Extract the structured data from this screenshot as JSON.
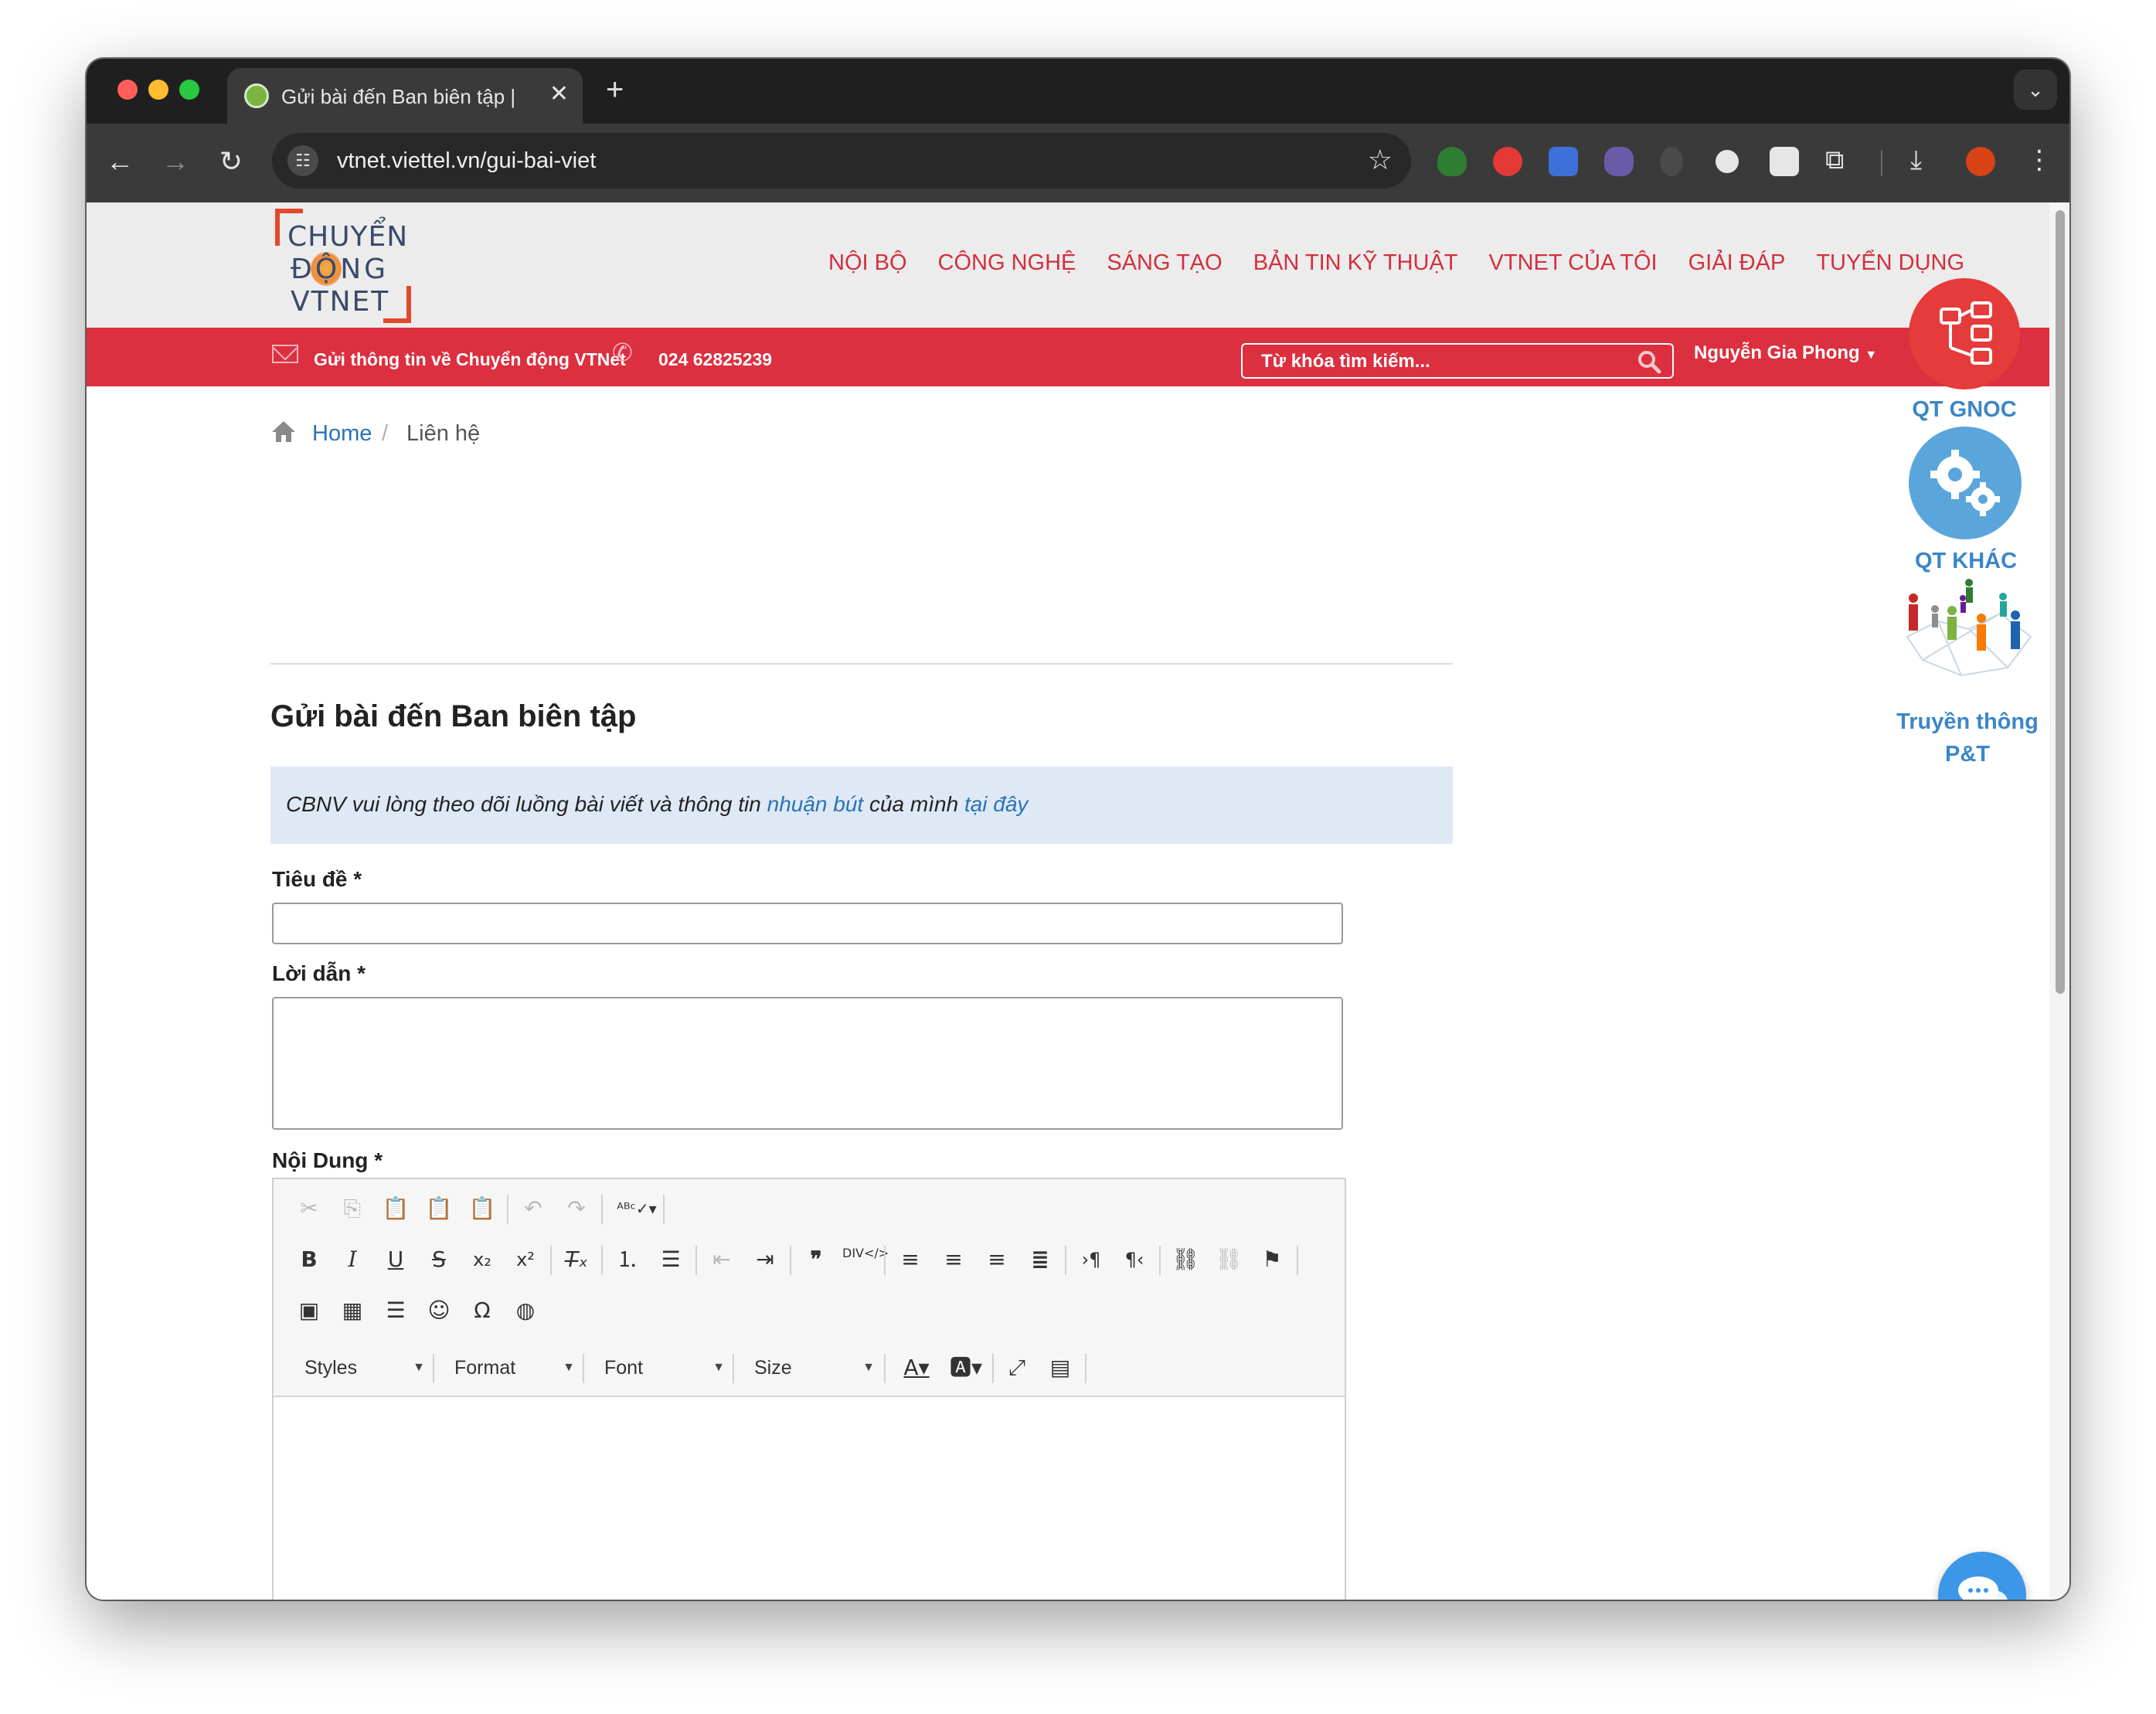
{
  "browser": {
    "tab_title": "Gửi bài đến Ban biên tập | Chuyển động VTNet",
    "tab_close": "✕",
    "new_tab": "+",
    "url": "vtnet.viettel.vn/gui-bai-viet"
  },
  "site": {
    "logo": {
      "line1": "CHUYỂN",
      "line2": "ĐỘNG",
      "line3": "VTNET"
    },
    "nav": [
      "NỘI BỘ",
      "CÔNG NGHỆ",
      "SÁNG TẠO",
      "BẢN TIN KỸ THUẬT",
      "VTNET CỦA TÔI",
      "GIẢI ĐÁP",
      "TUYỂN DỤNG"
    ],
    "topbar": {
      "mail_text": "Gửi thông tin về Chuyển động VTNet",
      "phone": "024 62825239",
      "search_placeholder": "Từ khóa tìm kiếm...",
      "user": "Nguyễn Gia Phong"
    }
  },
  "breadcrumb": {
    "home": "Home",
    "separator": "/",
    "current": "Liên hệ"
  },
  "page_title": "Gửi bài đến Ban biên tập",
  "notice": {
    "before": "CBNV vui lòng theo dõi luồng bài viết và thông tin ",
    "link1": "nhuận bút",
    "middle": " của mình ",
    "link2": "tại đây"
  },
  "form": {
    "title_label": "Tiêu đề *",
    "title_value": "",
    "lead_label": "Lời dẫn *",
    "lead_value": "",
    "content_label": "Nội Dung *"
  },
  "editor": {
    "combos": {
      "styles": "Styles",
      "format": "Format",
      "font": "Font",
      "size": "Size"
    }
  },
  "widgets": {
    "qt_gnoc": "QT GNOC",
    "qt_khac": "QT KHÁC",
    "truyen_thong_1": "Truyền thông",
    "truyen_thong_2": "P&T"
  },
  "colors": {
    "brand_red": "#dc2f3f",
    "nav_red": "#d32f3e",
    "link_blue": "#2a72b8",
    "notice_bg": "#dfe9f5"
  }
}
